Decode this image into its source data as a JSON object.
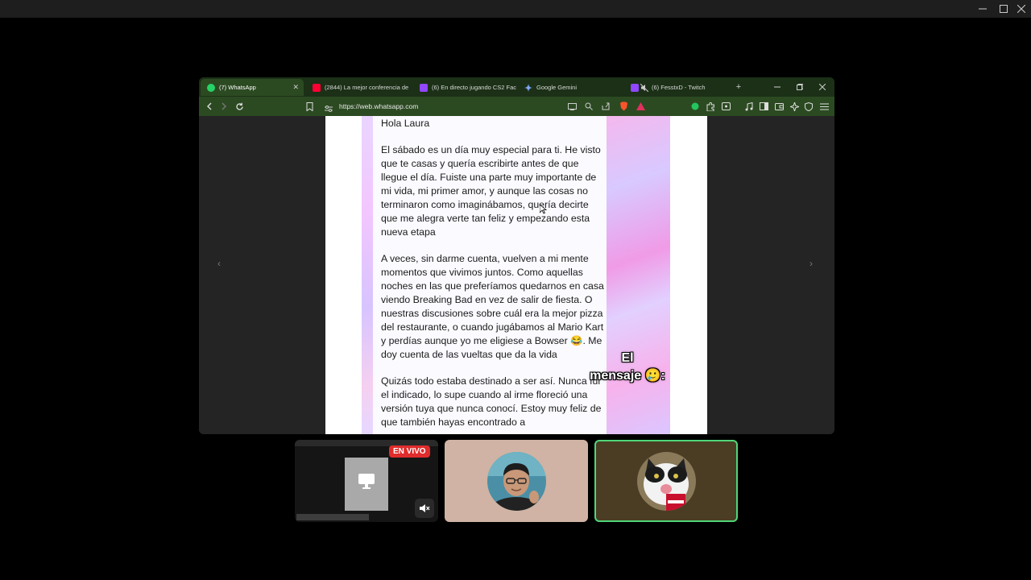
{
  "browser": {
    "tabs": [
      {
        "title": "(7) WhatsApp",
        "color": "#25d366",
        "active": true
      },
      {
        "title": "(2844) La mejor conferencia de",
        "color": "#ff0033",
        "active": false
      },
      {
        "title": "(6) En directo jugando CS2 Fac",
        "color": "#9146ff",
        "active": false
      },
      {
        "title": "Google Gemini",
        "color": "#4b8bf5",
        "active": false
      },
      {
        "title": "(6) FesstxD - Twitch",
        "color": "#9146ff",
        "active": false
      }
    ],
    "url": "https://web.whatsapp.com",
    "new_tab_label": "+"
  },
  "message": {
    "greeting": "Hola Laura",
    "paragraphs": [
      "El sábado es un día muy especial para ti. He visto que te casas y quería escribirte antes de que llegue el día. Fuiste una parte muy importante de mi vida, mi primer amor, y aunque las cosas no terminaron como imaginábamos, quería decirte que me alegra verte tan feliz y empezando esta nueva etapa",
      "A veces, sin darme cuenta, vuelven a mi mente momentos que vivimos juntos. Como aquellas noches en las que preferíamos quedarnos en casa viendo Breaking Bad en vez de salir de fiesta. O nuestras discusiones sobre cuál era la mejor pizza del restaurante, o cuando jugábamos al Mario Kart y perdías aunque yo me eligiese a Bowser 😂. Me doy cuenta de las vueltas que da la vida",
      "Quizás todo estaba destinado a ser así. Nunca fui el indicado, lo supe cuando al irme floreció una versión tuya que nunca conocí. Estoy muy feliz de que también hayas encontrado a"
    ]
  },
  "caption": {
    "line1": "El",
    "line2": "mensaje 🥲:"
  },
  "participants": {
    "live_badge": "EN VIVO",
    "accent": "#4fd679"
  },
  "colors": {
    "tabstrip": "#1b3016",
    "toolbar": "#2c4a22"
  }
}
